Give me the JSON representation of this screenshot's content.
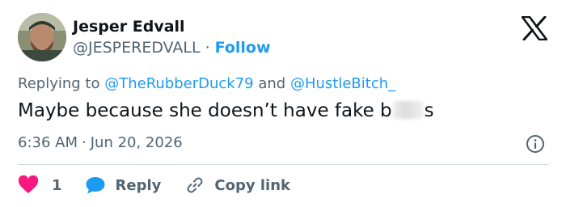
{
  "user": {
    "display_name": "Jesper Edvall",
    "handle": "@JESPEREDVALL",
    "separator": "·",
    "follow_label": "Follow"
  },
  "reply_context": {
    "prefix": "Replying to",
    "mention_1": "@TheRubberDuck79",
    "conjunction": "and",
    "mention_2": "@HustleBitch_"
  },
  "tweet": {
    "text_before": "Maybe because she doesn’t have fake b",
    "text_after": "s"
  },
  "meta": {
    "time": "6:36 AM",
    "separator": "·",
    "date": "Jun 20, 2026"
  },
  "actions": {
    "like_count": "1",
    "reply_label": "Reply",
    "copy_label": "Copy link"
  },
  "colors": {
    "accent": "#1d9bf0",
    "like": "#f91880",
    "muted": "#536471",
    "text": "#0f1419"
  },
  "icons": {
    "logo": "x-logo-icon",
    "info": "info-icon",
    "like": "heart-icon",
    "reply": "speech-bubble-icon",
    "copy": "link-icon"
  }
}
